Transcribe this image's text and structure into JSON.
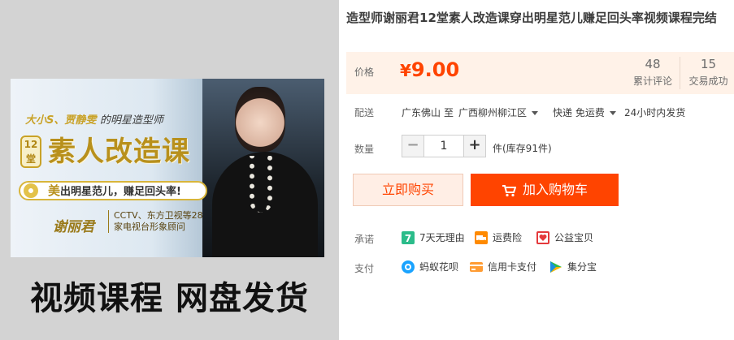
{
  "gallery": {
    "banner_top": "大小S、贾静雯",
    "banner_top_suffix": "的明星造型师",
    "badge": "12堂",
    "main": "素人改造课",
    "pill_em": "美",
    "pill_text": "出明星范儿，赚足回头率!",
    "name": "谢丽君",
    "desc_line1": "CCTV、东方卫视等28",
    "desc_line2": "家电视台形象顾问",
    "caption": "视频课程 网盘发货"
  },
  "product": {
    "title": "造型师谢丽君12堂素人改造课穿出明星范儿赚足回头率视频课程完结",
    "price_label": "价格",
    "currency": "¥",
    "price": "9.00",
    "reviews_count": "48",
    "reviews_label": "累计评论",
    "sales_count": "15",
    "sales_label": "交易成功"
  },
  "shipping": {
    "label": "配送",
    "from": "广东佛山",
    "to_word": "至",
    "to": "广西柳州柳江区",
    "method": "快递 免运费",
    "time": "24小时内发货"
  },
  "quantity": {
    "label": "数量",
    "minus": "−",
    "value": "1",
    "plus": "+",
    "unit": "件(库存91件)"
  },
  "actions": {
    "buy_now": "立即购买",
    "add_to_cart": "加入购物车"
  },
  "promise": {
    "label": "承诺",
    "items": [
      "7天无理由",
      "运费险",
      "公益宝贝"
    ]
  },
  "payment": {
    "label": "支付",
    "items": [
      "蚂蚁花呗",
      "信用卡支付",
      "集分宝"
    ]
  },
  "colors": {
    "accent": "#ff4400",
    "price_bg": "#fff2e8"
  }
}
